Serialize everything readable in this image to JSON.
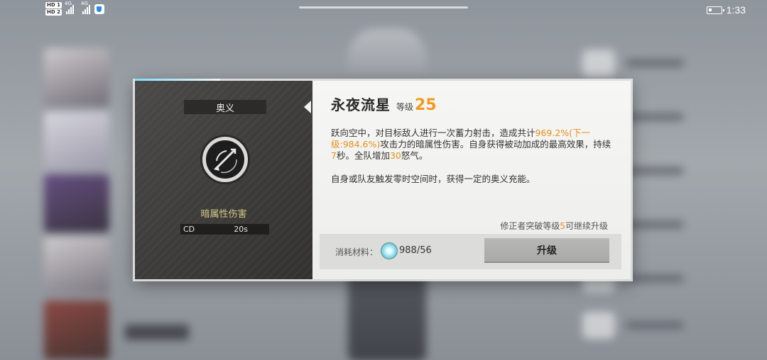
{
  "status_bar": {
    "hd1": "HD 1",
    "hd2": "HD 2",
    "signal1_gen": "4G",
    "signal2_gen": "4G",
    "time": "1:33"
  },
  "skill_panel": {
    "type_label": "奥义",
    "damage_type": "暗属性伤害",
    "cd_label": "CD",
    "cd_value": "20s",
    "icon": "arrow-target-icon"
  },
  "skill_detail": {
    "name": "永夜流星",
    "level_label": "等级",
    "level_value": "25",
    "description": {
      "p1": "跃向空中，对目标敌人进行一次蓄力射击，造成共计",
      "pct": "969.2%(下一级:984.6%)",
      "p2": "攻击力的暗属性伤害。自身获得被动加成的最高效果，持续",
      "duration": "7",
      "p3": "秒。全队增加",
      "rage": "30",
      "p4": "怒气。"
    },
    "description2": "自身或队友触发零时空间时，获得一定的奥义充能。",
    "upgrade_hint": {
      "prefix": "修正者突破等级",
      "level": "5",
      "suffix": "可继续升级"
    }
  },
  "footer": {
    "material_label": "消耗材料：",
    "material_icon": "crystal-icon",
    "material_count": "988/56",
    "upgrade_button": "升级"
  },
  "colors": {
    "highlight": "#e8901a",
    "damage_type": "#d6c98a",
    "level": "#f29a1d"
  }
}
